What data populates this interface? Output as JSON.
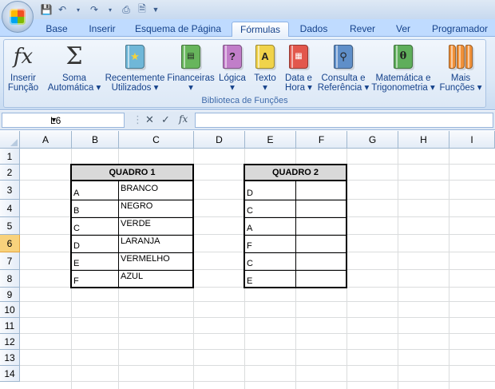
{
  "qat": {
    "icons": [
      "save-icon",
      "undo-icon",
      "redo-icon",
      "print-preview-icon",
      "customize-qat-icon"
    ]
  },
  "tabs": [
    "Base",
    "Inserir",
    "Esquema de Página",
    "Fórmulas",
    "Dados",
    "Rever",
    "Ver",
    "Programador"
  ],
  "active_tab": "Fórmulas",
  "ribbon": {
    "group_label": "Biblioteca de Funções",
    "buttons": [
      {
        "line1": "Inserir",
        "line2": "Função",
        "icon": "fx-icon"
      },
      {
        "line1": "Soma",
        "line2": "Automática ▾",
        "icon": "sigma-icon"
      },
      {
        "line1": "Recentemente",
        "line2": "Utilizados ▾",
        "icon": "star-book-icon",
        "color": "#6fb7d8"
      },
      {
        "line1": "Financeiras",
        "line2": "▾",
        "icon": "money-book-icon",
        "color": "#67b55c"
      },
      {
        "line1": "Lógica",
        "line2": "▾",
        "icon": "question-book-icon",
        "color": "#c17ec9"
      },
      {
        "line1": "Texto",
        "line2": "▾",
        "icon": "text-book-icon",
        "color": "#f0d34a"
      },
      {
        "line1": "Data e",
        "line2": "Hora ▾",
        "icon": "calendar-book-icon",
        "color": "#e2574c"
      },
      {
        "line1": "Consulta e",
        "line2": "Referência ▾",
        "icon": "lookup-book-icon",
        "color": "#5f8fc9"
      },
      {
        "line1": "Matemática e",
        "line2": "Trigonometria ▾",
        "icon": "theta-book-icon",
        "color": "#5fae5b"
      },
      {
        "line1": "Mais",
        "line2": "Funções ▾",
        "icon": "more-books-icon",
        "color": "#f0913a"
      }
    ]
  },
  "formula_bar": {
    "name_box": "L6",
    "cancel_icon": "✕",
    "enter_icon": "✓",
    "fx_label": "fx",
    "value": ""
  },
  "columns": [
    "A",
    "B",
    "C",
    "D",
    "E",
    "F",
    "G",
    "H",
    "I"
  ],
  "rows": [
    "1",
    "2",
    "3",
    "4",
    "5",
    "6",
    "7",
    "8",
    "9",
    "10",
    "11",
    "12",
    "13",
    "14"
  ],
  "selected_row": "6",
  "quadro1": {
    "title": "QUADRO 1",
    "col_b": [
      "A",
      "B",
      "C",
      "D",
      "E",
      "F"
    ],
    "col_c": [
      "BRANCO",
      "NEGRO",
      "VERDE",
      "LARANJA",
      "VERMELHO",
      "AZUL"
    ]
  },
  "quadro2": {
    "title": "QUADRO 2",
    "col_e": [
      "D",
      "C",
      "A",
      "F",
      "C",
      "E"
    ],
    "col_f": [
      "",
      "",
      "",
      "",
      "",
      ""
    ]
  }
}
